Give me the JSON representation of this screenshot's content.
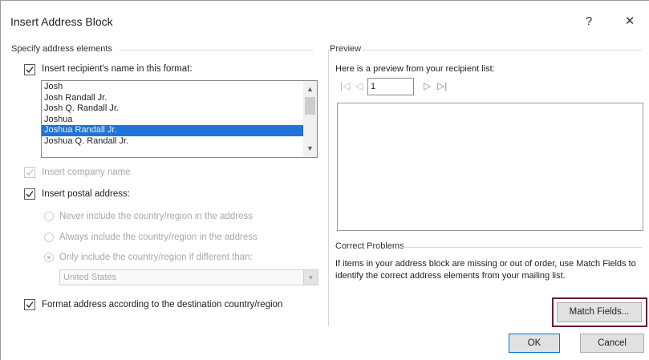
{
  "dialog": {
    "title": "Insert Address Block",
    "help_glyph": "?",
    "close_glyph": "✕"
  },
  "left": {
    "group_label": "Specify address elements",
    "recipient_name": {
      "label": "Insert recipient's name in this format:",
      "checked": true,
      "formats": [
        "Josh",
        "Josh Randall Jr.",
        "Josh Q. Randall Jr.",
        "Joshua",
        "Joshua Randall Jr.",
        "Joshua Q. Randall Jr."
      ],
      "selected_index": 4
    },
    "company_name": {
      "label": "Insert company name",
      "checked": true,
      "disabled": true
    },
    "postal_address": {
      "label": "Insert postal address:",
      "checked": true,
      "options": [
        {
          "label": "Never include the country/region in the address",
          "checked": false
        },
        {
          "label": "Always include the country/region in the address",
          "checked": false
        },
        {
          "label": "Only include the country/region if different than:",
          "checked": true
        }
      ],
      "country_value": "United States"
    },
    "format_address": {
      "label": "Format address according to the destination country/region",
      "checked": true
    }
  },
  "preview": {
    "group_label": "Preview",
    "intro": "Here is a preview from your recipient list:",
    "record_number": "1",
    "nav": {
      "first": "|◁",
      "prev": "◁",
      "next": "▷",
      "last": "▷|"
    }
  },
  "correct_problems": {
    "group_label": "Correct Problems",
    "text": "If items in your address block are missing or out of order, use Match Fields to identify the correct address elements from your mailing list.",
    "match_fields_label": "Match Fields..."
  },
  "buttons": {
    "ok_label": "OK",
    "cancel_label": "Cancel"
  },
  "colors": {
    "selection": "#1f74d6",
    "highlight_border": "#6b1b2f",
    "default_button_border": "#0078d7"
  }
}
